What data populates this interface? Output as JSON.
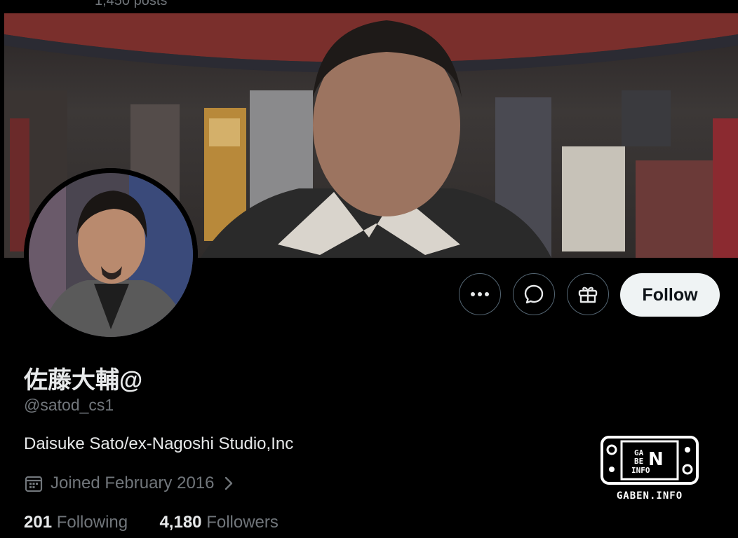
{
  "header": {
    "posts_count": "1,450 posts"
  },
  "profile": {
    "display_name": "佐藤大輔@",
    "handle": "@satod_cs1",
    "bio": "Daisuke Sato/ex-Nagoshi Studio,Inc",
    "joined": "Joined February 2016",
    "following_count": "201",
    "following_label": "Following",
    "followers_count": "4,180",
    "followers_label": "Followers"
  },
  "actions": {
    "more_icon": "more-icon",
    "message_icon": "message-icon",
    "gift_icon": "gift-icon",
    "follow_label": "Follow"
  },
  "watermark": {
    "text": "GABEN.INFO"
  },
  "colors": {
    "background": "#000000",
    "primary_text": "#e7e9ea",
    "secondary_text": "#71767b",
    "follow_button_bg": "#eff3f4",
    "button_border": "#536471"
  }
}
